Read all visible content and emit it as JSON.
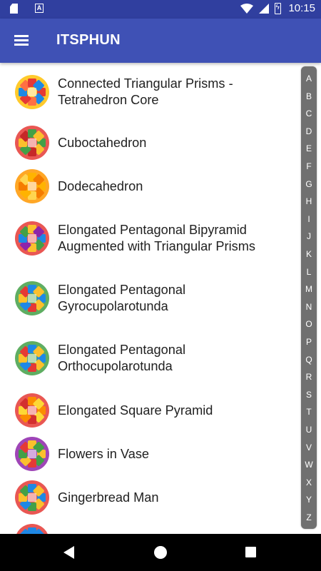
{
  "status_bar": {
    "time": "10:15",
    "icons": [
      "sd-card-icon",
      "a-notification-icon",
      "wifi-icon",
      "signal-icon",
      "battery-charging-icon"
    ]
  },
  "app_bar": {
    "title": "ITSPHUN",
    "menu_icon": "hamburger-menu-icon"
  },
  "list": {
    "items": [
      {
        "label_lines": [
          "Connected Triangular Prisms -",
          "Tetrahedron Core"
        ],
        "thumb_colors": [
          "#FFC107",
          "#E53935",
          "#1E88E5",
          "#FF7043"
        ]
      },
      {
        "label_lines": [
          "Cuboctahedron"
        ],
        "thumb_colors": [
          "#E53935",
          "#43A047",
          "#FBC02D",
          "#C62828"
        ]
      },
      {
        "label_lines": [
          "Dodecahedron"
        ],
        "thumb_colors": [
          "#FF9800",
          "#FFB300",
          "#F57C00",
          "#FFD54F"
        ]
      },
      {
        "label_lines": [
          "Elongated Pentagonal Bipyramid",
          "Augmented with Triangular Prisms"
        ],
        "thumb_colors": [
          "#E53935",
          "#1E88E5",
          "#43A047",
          "#FBC02D",
          "#8E24AA"
        ]
      },
      {
        "label_lines": [
          "Elongated Pentagonal",
          "Gyrocupolarotunda"
        ],
        "thumb_colors": [
          "#43A047",
          "#1E88E5",
          "#FBC02D",
          "#E53935"
        ]
      },
      {
        "label_lines": [
          "Elongated Pentagonal",
          "Orthocupolarotunda"
        ],
        "thumb_colors": [
          "#43A047",
          "#1E88E5",
          "#FBC02D",
          "#E53935"
        ]
      },
      {
        "label_lines": [
          "Elongated Square Pyramid"
        ],
        "thumb_colors": [
          "#E53935",
          "#FB8C00",
          "#FDD835",
          "#D32F2F"
        ]
      },
      {
        "label_lines": [
          "Flowers in Vase"
        ],
        "thumb_colors": [
          "#8E24AA",
          "#FBC02D",
          "#43A047",
          "#E53935"
        ]
      },
      {
        "label_lines": [
          "Gingerbread Man"
        ],
        "thumb_colors": [
          "#E53935",
          "#1E88E5",
          "#FBC02D",
          "#43A047"
        ]
      },
      {
        "label_lines": [
          ""
        ],
        "thumb_colors": [
          "#E53935",
          "#1E88E5"
        ]
      }
    ]
  },
  "index_bar": {
    "letters": [
      "A",
      "B",
      "C",
      "D",
      "E",
      "F",
      "G",
      "H",
      "I",
      "J",
      "K",
      "L",
      "M",
      "N",
      "O",
      "P",
      "Q",
      "R",
      "S",
      "T",
      "U",
      "V",
      "W",
      "X",
      "Y",
      "Z"
    ]
  },
  "nav_bar": {
    "icons": [
      "back-icon",
      "home-icon",
      "recents-icon"
    ]
  }
}
